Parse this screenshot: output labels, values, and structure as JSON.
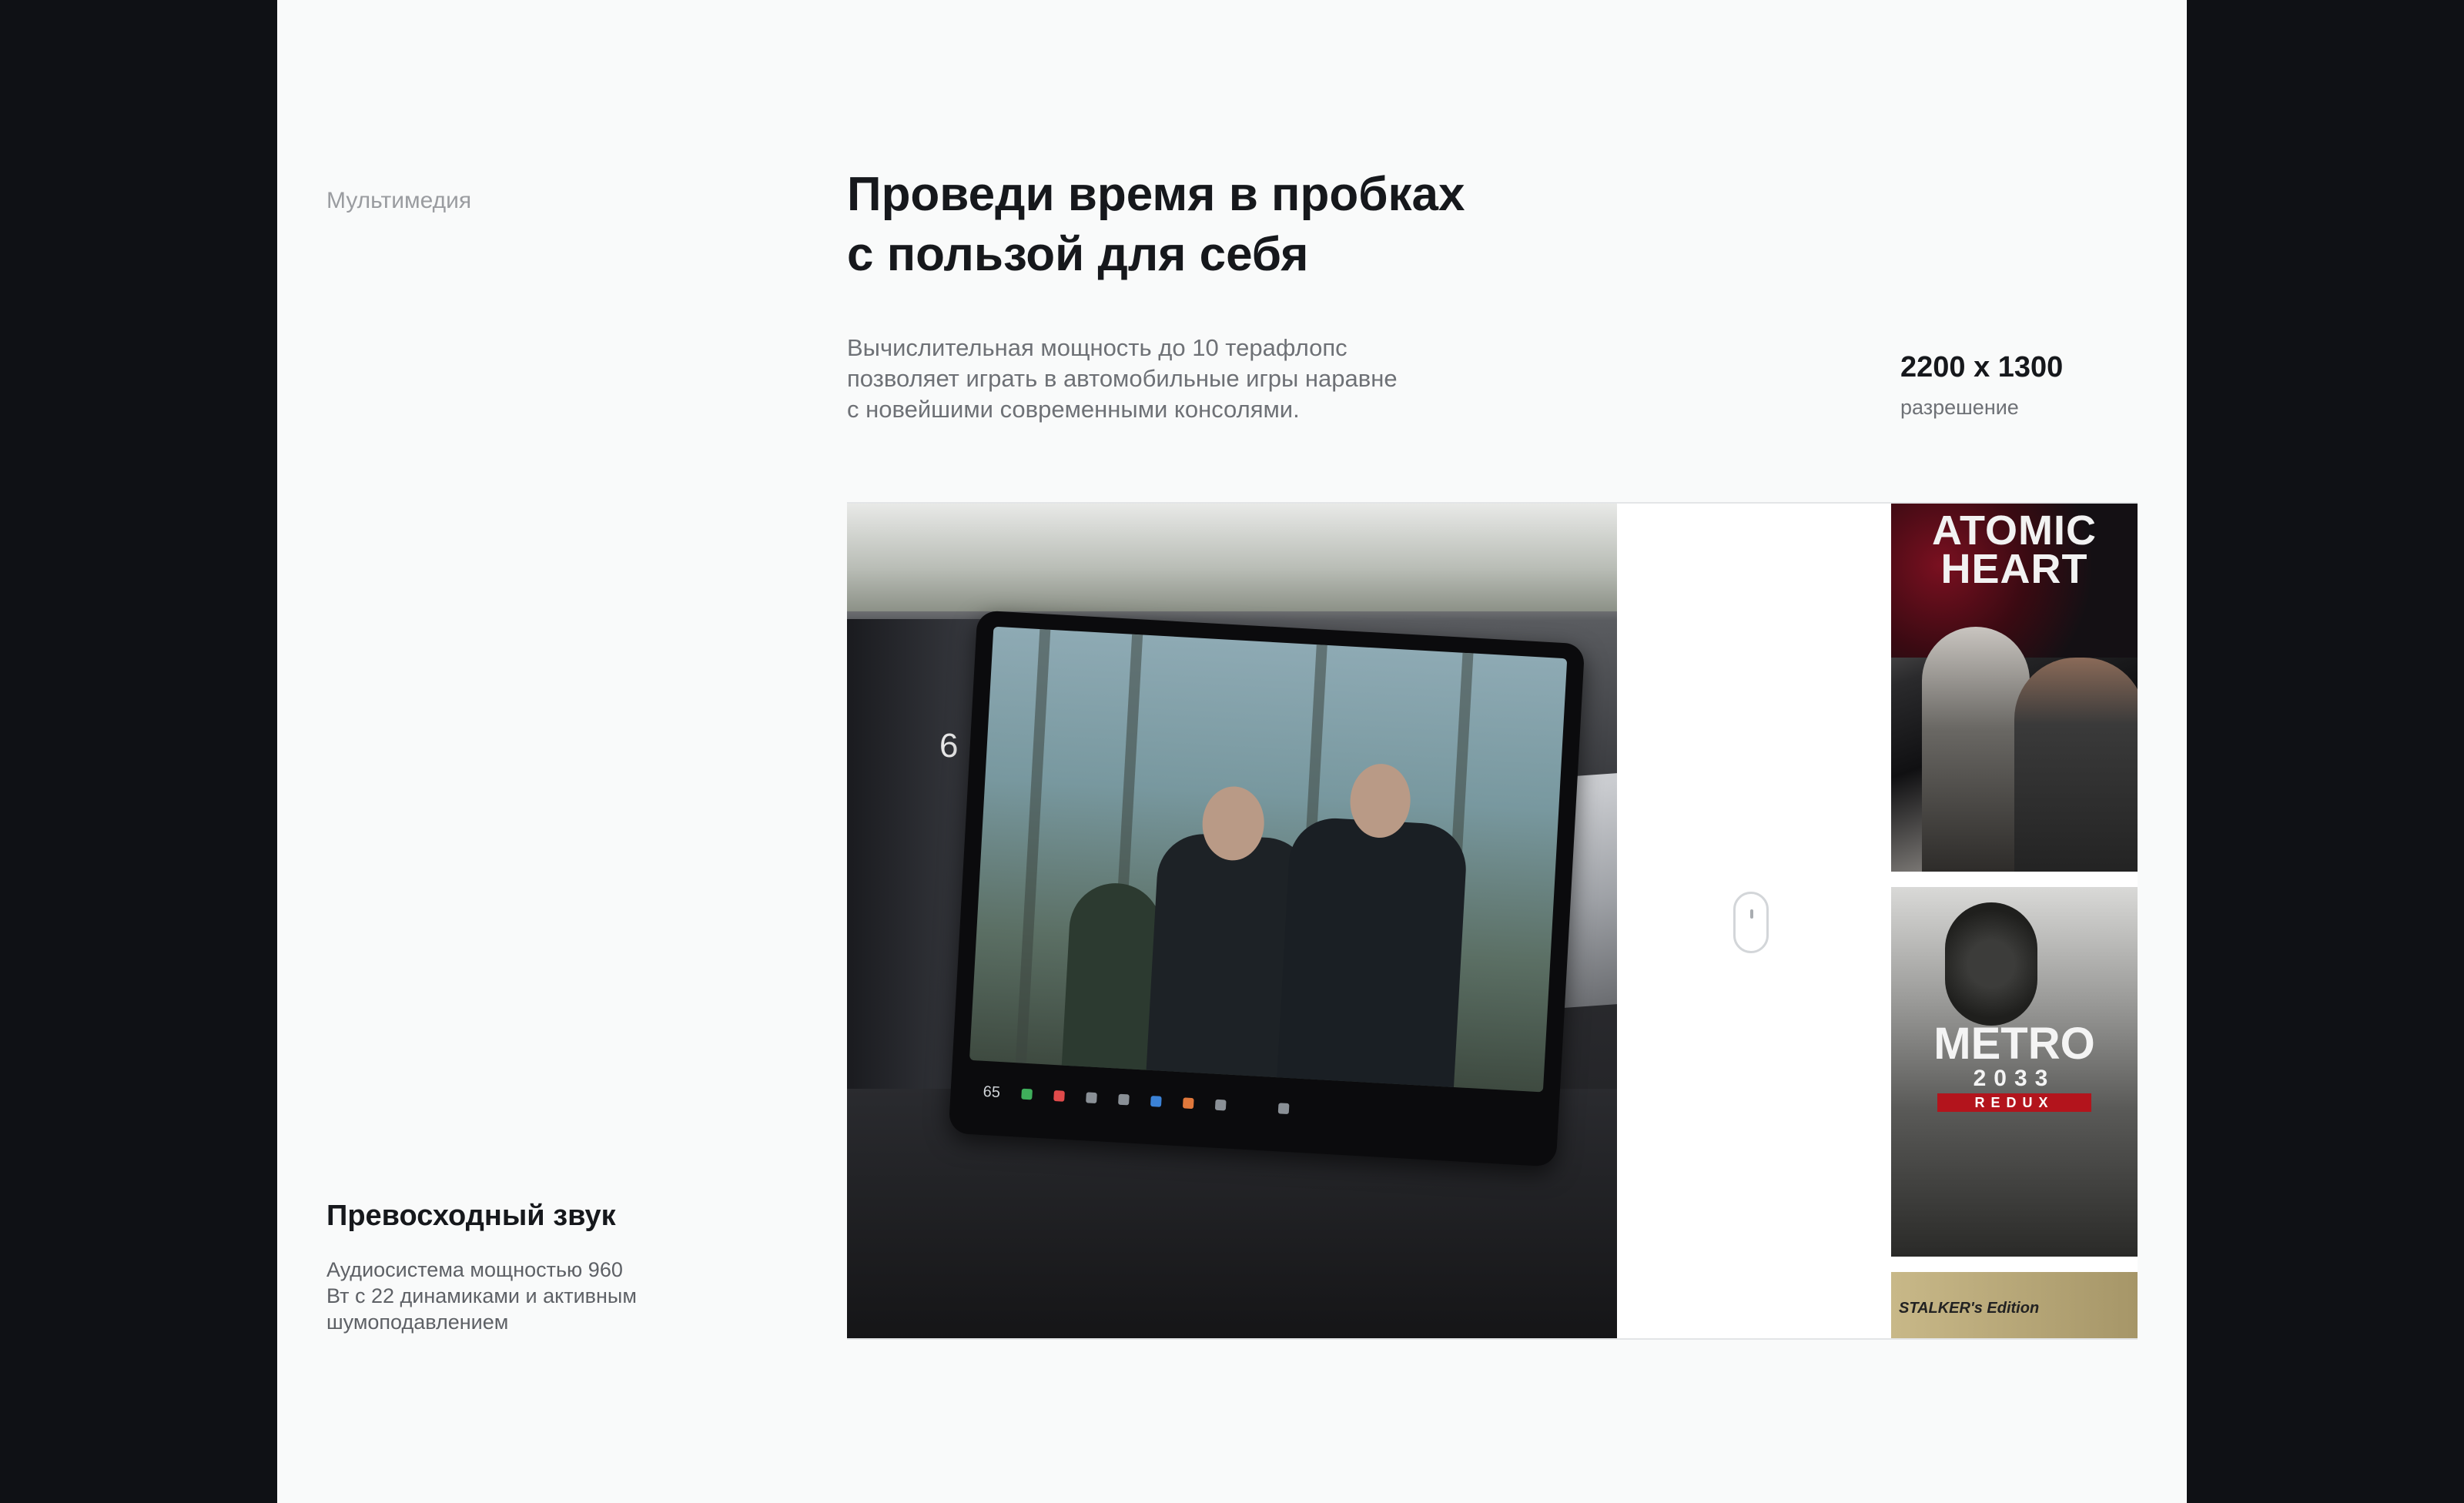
{
  "section": {
    "label": "Мультимедия"
  },
  "headline": {
    "line1": "Проведи время в пробках",
    "line2": "с пользой для себя"
  },
  "description": {
    "line1": "Вычислительная мощность до 10 терафлопс",
    "line2": "позволяет играть в автомобильные игры наравне",
    "line3": "с новейшими современными консолями."
  },
  "spec": {
    "value": "2200 x 1300",
    "label": "разрешение"
  },
  "gallery": {
    "screen_speed": "65",
    "dash_gear": "6",
    "games": [
      {
        "title_line1": "ATOMIC",
        "title_line2": "HEART"
      },
      {
        "title": "METRO",
        "subtitle": "2033",
        "edition": "REDUX"
      },
      {
        "title": "STALKER's Edition"
      }
    ],
    "scroll_hint_icon": "mouse-icon"
  },
  "feature": {
    "title": "Превосходный звук",
    "line1": "Аудиосистема мощностью 960",
    "line2": "Вт с 22 динамиками и активным",
    "line3": "шумоподавлением"
  },
  "colors": {
    "background": "#0f1115",
    "page": "#f9fafa",
    "text": "#16181c",
    "muted": "#6e7176"
  }
}
